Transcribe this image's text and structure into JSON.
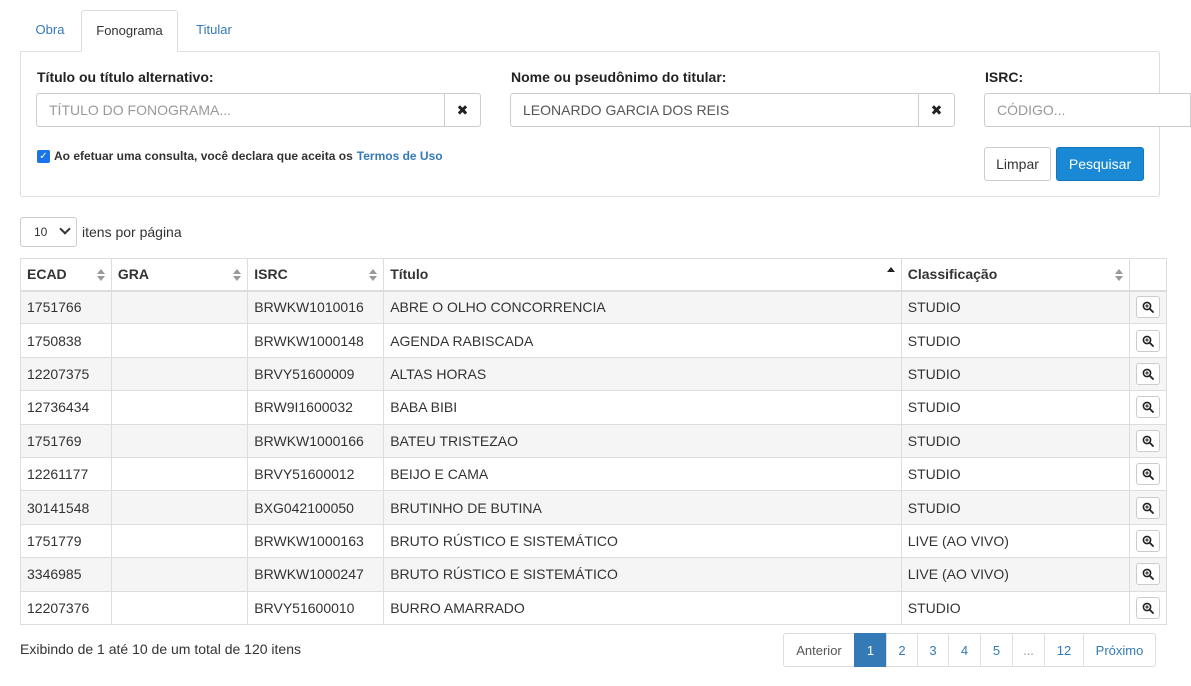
{
  "tabs": [
    {
      "label": "Obra"
    },
    {
      "label": "Fonograma"
    },
    {
      "label": "Titular"
    }
  ],
  "search": {
    "title_label": "Título ou título alternativo:",
    "title_placeholder": "TÍTULO DO FONOGRAMA...",
    "title_value": "",
    "holder_label": "Nome ou pseudônimo do titular:",
    "holder_value": "LEONARDO GARCIA DOS REIS",
    "isrc_label": "ISRC:",
    "isrc_placeholder": "CÓDIGO...",
    "isrc_value": "",
    "terms_text": "Ao efetuar uma consulta, você declara que aceita os",
    "terms_link": "Termos de Uso",
    "terms_checked": true,
    "clear_label": "Limpar",
    "search_label": "Pesquisar"
  },
  "page_size": {
    "value": "10",
    "label": "itens por página"
  },
  "table": {
    "headers": [
      "ECAD",
      "GRA",
      "ISRC",
      "Título",
      "Classificação"
    ],
    "sorted_column": "Título",
    "rows": [
      {
        "ecad": "1751766",
        "gra": "",
        "isrc": "BRWKW1010016",
        "titulo": "ABRE O OLHO CONCORRENCIA",
        "classificacao": "STUDIO"
      },
      {
        "ecad": "1750838",
        "gra": "",
        "isrc": "BRWKW1000148",
        "titulo": "AGENDA RABISCADA",
        "classificacao": "STUDIO"
      },
      {
        "ecad": "12207375",
        "gra": "",
        "isrc": "BRVY51600009",
        "titulo": "ALTAS HORAS",
        "classificacao": "STUDIO"
      },
      {
        "ecad": "12736434",
        "gra": "",
        "isrc": "BRW9I1600032",
        "titulo": "BABA BIBI",
        "classificacao": "STUDIO"
      },
      {
        "ecad": "1751769",
        "gra": "",
        "isrc": "BRWKW1000166",
        "titulo": "BATEU TRISTEZAO",
        "classificacao": "STUDIO"
      },
      {
        "ecad": "12261177",
        "gra": "",
        "isrc": "BRVY51600012",
        "titulo": "BEIJO E CAMA",
        "classificacao": "STUDIO"
      },
      {
        "ecad": "30141548",
        "gra": "",
        "isrc": "BXG042100050",
        "titulo": "BRUTINHO DE BUTINA",
        "classificacao": "STUDIO"
      },
      {
        "ecad": "1751779",
        "gra": "",
        "isrc": "BRWKW1000163",
        "titulo": "BRUTO RÚSTICO E SISTEMÁTICO",
        "classificacao": "LIVE (AO VIVO)"
      },
      {
        "ecad": "3346985",
        "gra": "",
        "isrc": "BRWKW1000247",
        "titulo": "BRUTO RÚSTICO E SISTEMÁTICO",
        "classificacao": "LIVE (AO VIVO)"
      },
      {
        "ecad": "12207376",
        "gra": "",
        "isrc": "BRVY51600010",
        "titulo": "BURRO AMARRADO",
        "classificacao": "STUDIO"
      }
    ]
  },
  "footer": {
    "summary": "Exibindo de 1 até 10 de um total de 120 itens",
    "pages": [
      "Anterior",
      "1",
      "2",
      "3",
      "4",
      "5",
      "...",
      "12",
      "Próximo"
    ],
    "active_page": "1"
  },
  "colors": {
    "primary": "#1989d5",
    "link": "#337ab7",
    "active_page": "#337ab7"
  }
}
